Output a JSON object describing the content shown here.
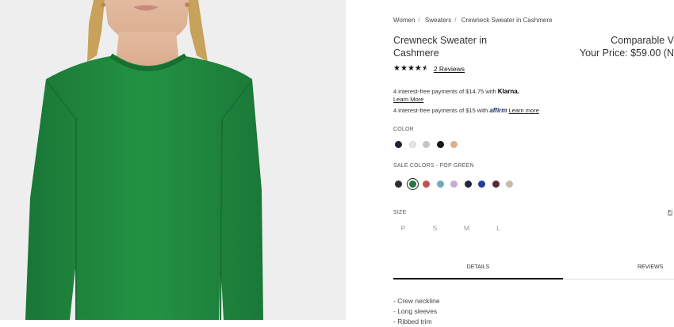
{
  "breadcrumb": [
    "Women",
    "Sweaters",
    "Crewneck Sweater in Cashmere"
  ],
  "product": {
    "title": "Crewneck Sweater in Cashmere",
    "comparable": "Comparable V",
    "your_price": "Your Price: $59.00 (N"
  },
  "rating": {
    "value": 4.5,
    "out_of": 5,
    "reviews_label": "2 Reviews"
  },
  "payments": {
    "klarna_text": "4 interest-free payments of $14.75 with",
    "klarna_brand": "Klarna.",
    "klarna_learn": "Learn More",
    "affirm_text": "4 interest-free payments of $15 with",
    "affirm_brand": "affirm",
    "affirm_learn": "Learn more"
  },
  "colors": {
    "label": "COLOR",
    "swatches": [
      "#1c2433",
      "#e6e6e6",
      "#c6c6c6",
      "#161616",
      "#d7b18f"
    ]
  },
  "sale_colors": {
    "label": "SALE COLORS - POP GREEN",
    "selected_index": 1,
    "swatches": [
      "#2b2e33",
      "#1f7a3d",
      "#c0524e",
      "#74a9bd",
      "#c4aed2",
      "#1c2a3d",
      "#1f3fa0",
      "#5a2a33",
      "#cbb8aa"
    ]
  },
  "size": {
    "label": "SIZE",
    "fit_link": "Fi",
    "options": [
      "P",
      "S",
      "M",
      "L"
    ]
  },
  "tabs": [
    "DETAILS",
    "REVIEWS"
  ],
  "details": [
    "- Crew neckline",
    "- Long sleeves",
    "- Ribbed trim"
  ],
  "theme": {
    "sweater": "#1f8a3f",
    "background": "#eeeeee"
  }
}
